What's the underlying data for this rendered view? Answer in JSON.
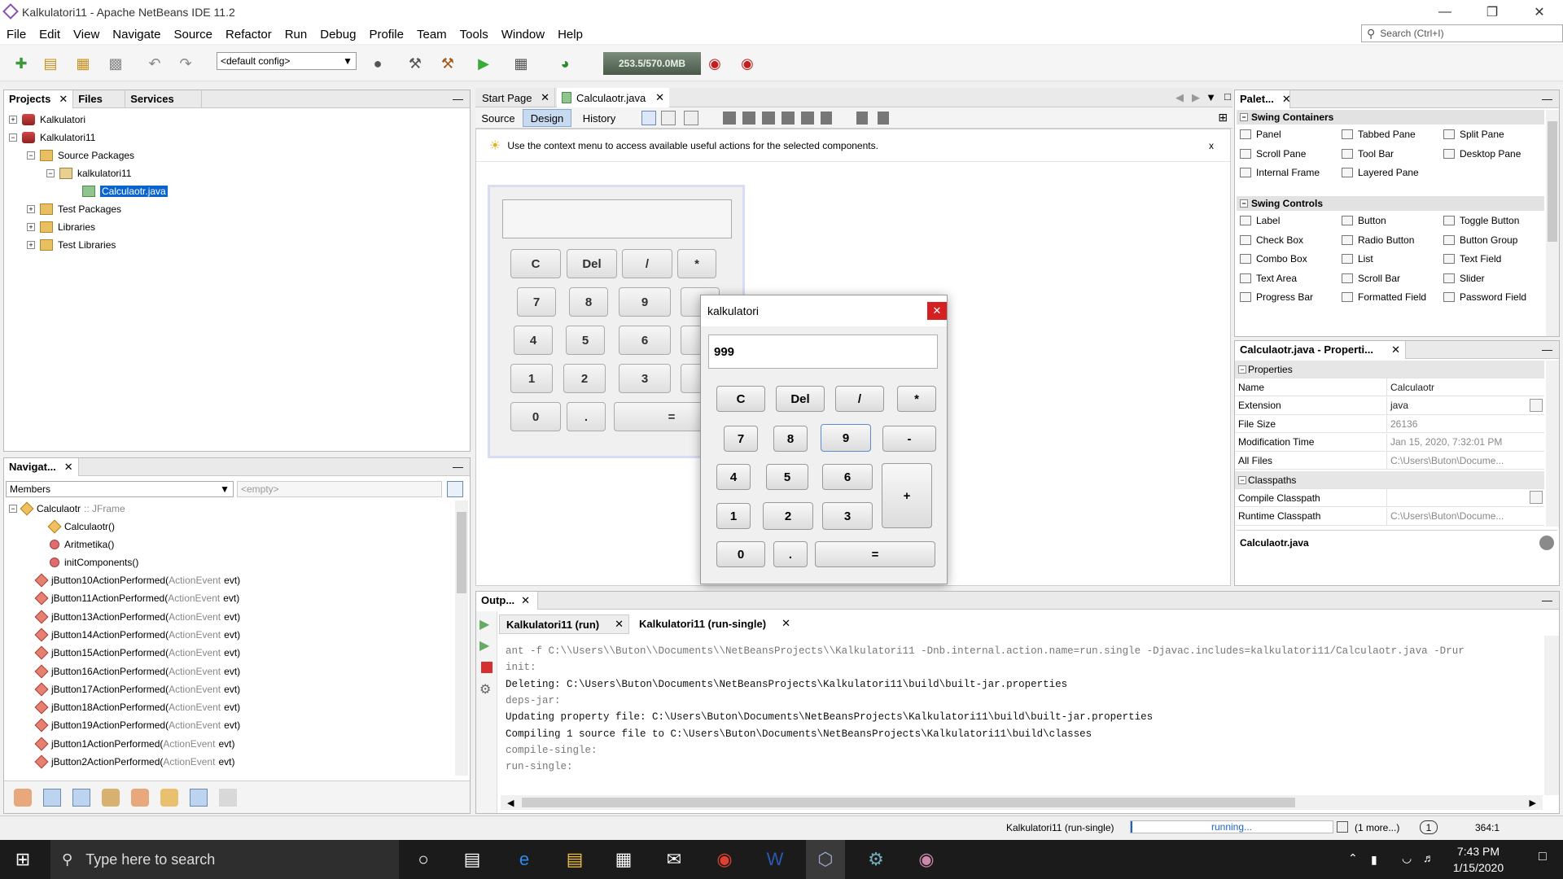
{
  "window": {
    "title": "Kalkulatori11 - Apache NetBeans IDE 11.2"
  },
  "menu": [
    "File",
    "Edit",
    "View",
    "Navigate",
    "Source",
    "Refactor",
    "Run",
    "Debug",
    "Profile",
    "Team",
    "Tools",
    "Window",
    "Help"
  ],
  "search": {
    "placeholder": "Search (Ctrl+I)"
  },
  "toolbar": {
    "config": "<default config>",
    "memory": "253.5/570.0MB"
  },
  "projects": {
    "tabs": [
      "Projects",
      "Files",
      "Services"
    ],
    "tree": [
      "Kalkulatori",
      "Kalkulatori11",
      "Source Packages",
      "kalkulatori11",
      "Calculaotr.java",
      "Test Packages",
      "Libraries",
      "Test Libraries"
    ]
  },
  "navigator": {
    "title": "Navigat...",
    "filter": "Members",
    "empty": "<empty>",
    "root": "Calculaotr",
    "root_type": ":: JFrame",
    "members": [
      "Calculaotr()",
      "Aritmetika()",
      "initComponents()"
    ],
    "handlers": [
      "jButton10ActionPerformed",
      "jButton11ActionPerformed",
      "jButton13ActionPerformed",
      "jButton14ActionPerformed",
      "jButton15ActionPerformed",
      "jButton16ActionPerformed",
      "jButton17ActionPerformed",
      "jButton18ActionPerformed",
      "jButton19ActionPerformed",
      "jButton1ActionPerformed",
      "jButton2ActionPerformed"
    ],
    "param_type": "ActionEvent",
    "param_name": "evt)"
  },
  "editor": {
    "tabs": [
      "Start Page",
      "Calculaotr.java"
    ],
    "subtabs": [
      "Source",
      "Design",
      "History"
    ],
    "hint": "Use the context menu to access available useful actions for the selected components.",
    "close_hint": "x"
  },
  "design_keys": [
    "C",
    "Del",
    "/",
    "*",
    "7",
    "8",
    "9",
    "4",
    "5",
    "6",
    "1",
    "2",
    "3",
    "0",
    ".",
    "="
  ],
  "dialog": {
    "title": "kalkulatori",
    "display": "999",
    "keys": [
      "C",
      "Del",
      "/",
      "*",
      "7",
      "8",
      "9",
      "-",
      "4",
      "5",
      "6",
      "+",
      "1",
      "2",
      "3",
      "0",
      ".",
      "="
    ]
  },
  "palette": {
    "title": "Palet...",
    "swing_containers": "Swing Containers",
    "containers": [
      "Panel",
      "Tabbed Pane",
      "Split Pane",
      "Scroll Pane",
      "Tool Bar",
      "Desktop Pane",
      "Internal Frame",
      "Layered Pane"
    ],
    "swing_controls": "Swing Controls",
    "controls": [
      "Label",
      "Button",
      "Toggle Button",
      "Check Box",
      "Radio Button",
      "Button Group",
      "Combo Box",
      "List",
      "Text Field",
      "Text Area",
      "Scroll Bar",
      "Slider",
      "Progress Bar",
      "Formatted Field",
      "Password Field"
    ]
  },
  "properties": {
    "title": "Calculaotr.java - Properti...",
    "section1": "Properties",
    "rows": [
      {
        "k": "Name",
        "v": "Calculaotr"
      },
      {
        "k": "Extension",
        "v": "java"
      },
      {
        "k": "File Size",
        "v": "26136"
      },
      {
        "k": "Modification Time",
        "v": "Jan 15, 2020, 7:32:01 PM"
      },
      {
        "k": "All Files",
        "v": "C:\\Users\\Buton\\Docume..."
      }
    ],
    "section2": "Classpaths",
    "rows2": [
      {
        "k": "Compile Classpath",
        "v": ""
      },
      {
        "k": "Runtime Classpath",
        "v": "C:\\Users\\Buton\\Docume..."
      }
    ],
    "footer": "Calculaotr.java"
  },
  "output": {
    "title": "Outp...",
    "tabs": [
      "Kalkulatori11 (run)",
      "Kalkulatori11 (run-single)"
    ],
    "lines": [
      "ant -f C:\\\\Users\\\\Buton\\\\Documents\\\\NetBeansProjects\\\\Kalkulatori11 -Dnb.internal.action.name=run.single -Djavac.includes=kalkulatori11/Calculaotr.java -Drur",
      "init:",
      "Deleting: C:\\Users\\Buton\\Documents\\NetBeansProjects\\Kalkulatori11\\build\\built-jar.properties",
      "deps-jar:",
      "Updating property file: C:\\Users\\Buton\\Documents\\NetBeansProjects\\Kalkulatori11\\build\\built-jar.properties",
      "Compiling 1 source file to C:\\Users\\Buton\\Documents\\NetBeansProjects\\Kalkulatori11\\build\\classes",
      "compile-single:",
      "run-single:"
    ]
  },
  "status": {
    "task": "Kalkulatori11 (run-single)",
    "progress": "running...",
    "more": "(1 more...)",
    "count": "1",
    "pos": "364:1"
  },
  "taskbar": {
    "search": "Type here to search",
    "time": "7:43 PM",
    "date": "1/15/2020"
  }
}
